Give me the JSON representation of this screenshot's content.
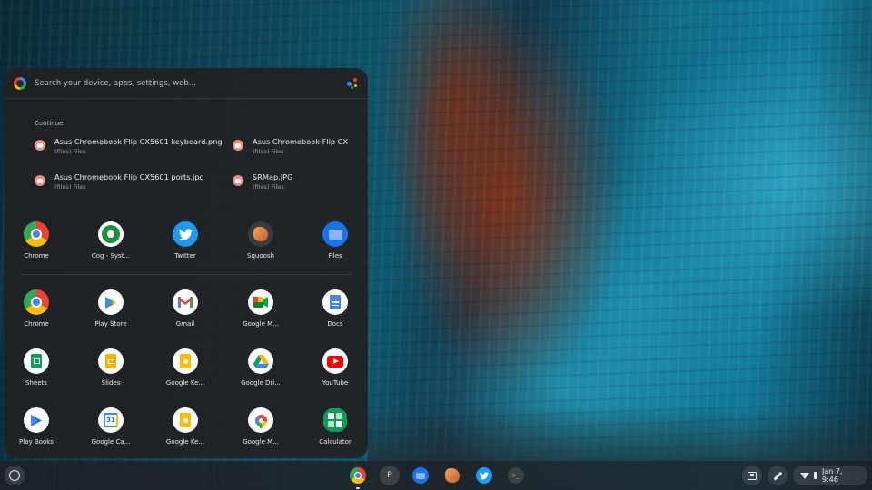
{
  "search": {
    "placeholder": "Search your device, apps, settings, web..."
  },
  "continue": {
    "label": "Continue",
    "items": [
      {
        "title": "Asus Chromebook Flip CX5601 keyboard.png",
        "source": "(files) Files"
      },
      {
        "title": "Asus Chromebook Flip CX",
        "source": "(files) Files"
      },
      {
        "title": "Asus Chromebook Flip CX5601 ports.jpg",
        "source": "(files) Files"
      },
      {
        "title": "SRMap.JPG",
        "source": "(files) Files"
      }
    ]
  },
  "recent_apps": [
    {
      "label": "Chrome",
      "icon": "chrome-icon"
    },
    {
      "label": "Cog - Syst...",
      "icon": "cog-icon"
    },
    {
      "label": "Twitter",
      "icon": "twitter-icon"
    },
    {
      "label": "Squoosh",
      "icon": "squoosh-icon"
    },
    {
      "label": "Files",
      "icon": "files-icon"
    }
  ],
  "apps": [
    {
      "label": "Chrome",
      "icon": "chrome-icon"
    },
    {
      "label": "Play Store",
      "icon": "play-store-icon"
    },
    {
      "label": "Gmail",
      "icon": "gmail-icon"
    },
    {
      "label": "Google M...",
      "icon": "google-meet-icon"
    },
    {
      "label": "Docs",
      "icon": "docs-icon"
    },
    {
      "label": "Sheets",
      "icon": "sheets-icon"
    },
    {
      "label": "Slides",
      "icon": "slides-icon"
    },
    {
      "label": "Google Ke...",
      "icon": "google-keep-icon"
    },
    {
      "label": "Google Dri...",
      "icon": "google-drive-icon"
    },
    {
      "label": "YouTube",
      "icon": "youtube-icon"
    },
    {
      "label": "Play Books",
      "icon": "play-books-icon"
    },
    {
      "label": "Google Ca...",
      "icon": "google-calendar-icon"
    },
    {
      "label": "Google Ke...",
      "icon": "google-keep-icon"
    },
    {
      "label": "Google M...",
      "icon": "google-maps-icon"
    },
    {
      "label": "Calculator",
      "icon": "calculator-icon"
    }
  ],
  "shelf": {
    "pinned": [
      {
        "icon": "chrome-icon",
        "running": true
      },
      {
        "icon": "profile-p-icon",
        "letter": "P",
        "running": false
      },
      {
        "icon": "files-icon",
        "running": false
      },
      {
        "icon": "squoosh-icon",
        "running": false
      },
      {
        "icon": "twitter-icon",
        "running": false
      },
      {
        "icon": "terminal-icon",
        "letter": ">_",
        "running": false
      }
    ],
    "status": {
      "clock": "Jan 7, 9:46"
    }
  },
  "colors": {
    "launcher_bg": "#202124",
    "text": "#e8eaed",
    "subtext": "#9aa0a6",
    "file_icon": "#f28b82"
  }
}
